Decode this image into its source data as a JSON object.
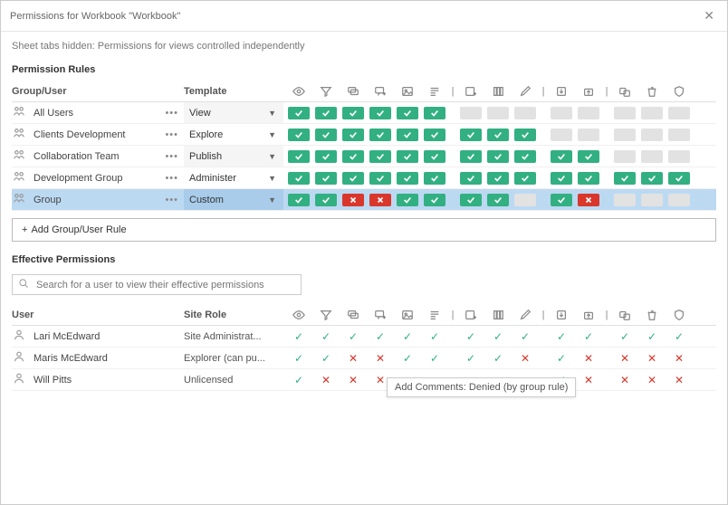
{
  "dialog": {
    "title": "Permissions for Workbook \"Workbook\"",
    "subtitle": "Sheet tabs hidden: Permissions for views controlled independently"
  },
  "sections": {
    "rules_title": "Permission Rules",
    "effective_title": "Effective Permissions"
  },
  "headers": {
    "group_user": "Group/User",
    "template": "Template",
    "user": "User",
    "site_role": "Site Role"
  },
  "perm_columns": [
    {
      "key": "view",
      "name": "view-icon"
    },
    {
      "key": "filter",
      "name": "filter-icon"
    },
    {
      "key": "comment",
      "name": "comment-icon"
    },
    {
      "key": "addcomment",
      "name": "add-comment-icon"
    },
    {
      "key": "image",
      "name": "image-icon"
    },
    {
      "key": "summary",
      "name": "summary-data-icon"
    },
    {
      "key": "SEP"
    },
    {
      "key": "share",
      "name": "share-custom-icon"
    },
    {
      "key": "fulldata",
      "name": "full-data-icon"
    },
    {
      "key": "webedit",
      "name": "web-edit-icon"
    },
    {
      "key": "SEP"
    },
    {
      "key": "download",
      "name": "download-workbook-icon"
    },
    {
      "key": "overwrite",
      "name": "overwrite-icon"
    },
    {
      "key": "SEP"
    },
    {
      "key": "move",
      "name": "move-icon"
    },
    {
      "key": "delete",
      "name": "delete-icon"
    },
    {
      "key": "setperm",
      "name": "set-permissions-icon"
    }
  ],
  "rules": [
    {
      "name": "All Users",
      "template": "View",
      "shaded": true,
      "perms": [
        "allow",
        "allow",
        "allow",
        "allow",
        "allow",
        "allow",
        "SEP",
        "none",
        "none",
        "none",
        "SEP",
        "none",
        "none",
        "SEP",
        "none",
        "none",
        "none"
      ]
    },
    {
      "name": "Clients Development",
      "template": "Explore",
      "shaded": false,
      "perms": [
        "allow",
        "allow",
        "allow",
        "allow",
        "allow",
        "allow",
        "SEP",
        "allow",
        "allow",
        "allow",
        "SEP",
        "none",
        "none",
        "SEP",
        "none",
        "none",
        "none"
      ]
    },
    {
      "name": "Collaboration Team",
      "template": "Publish",
      "shaded": true,
      "perms": [
        "allow",
        "allow",
        "allow",
        "allow",
        "allow",
        "allow",
        "SEP",
        "allow",
        "allow",
        "allow",
        "SEP",
        "allow",
        "allow",
        "SEP",
        "none",
        "none",
        "none"
      ]
    },
    {
      "name": "Development Group",
      "template": "Administer",
      "shaded": false,
      "perms": [
        "allow",
        "allow",
        "allow",
        "allow",
        "allow",
        "allow",
        "SEP",
        "allow",
        "allow",
        "allow",
        "SEP",
        "allow",
        "allow",
        "SEP",
        "allow",
        "allow",
        "allow"
      ]
    },
    {
      "name": "Group",
      "template": "Custom",
      "shaded": true,
      "selected": true,
      "perms": [
        "allow",
        "allow",
        "deny",
        "deny",
        "allow",
        "allow",
        "SEP",
        "allow",
        "allow",
        "none",
        "SEP",
        "allow",
        "deny",
        "SEP",
        "none",
        "none",
        "none"
      ]
    }
  ],
  "add_rule_label": "Add Group/User Rule",
  "search_placeholder": "Search for a user to view their effective permissions",
  "effective": [
    {
      "name": "Lari McEdward",
      "role": "Site Administrat...",
      "perms": [
        "allow",
        "allow",
        "allow",
        "allow",
        "allow",
        "allow",
        "SEP",
        "allow",
        "allow",
        "allow",
        "SEP",
        "allow",
        "allow",
        "SEP",
        "allow",
        "allow",
        "allow"
      ]
    },
    {
      "name": "Maris McEdward",
      "role": "Explorer (can pu...",
      "perms": [
        "allow",
        "allow",
        "deny",
        "deny",
        "allow",
        "allow",
        "SEP",
        "allow",
        "allow",
        "deny",
        "SEP",
        "allow",
        "deny",
        "SEP",
        "deny",
        "deny",
        "deny"
      ]
    },
    {
      "name": "Will Pitts",
      "role": "Unlicensed",
      "perms": [
        "allow",
        "deny",
        "deny",
        "deny",
        "TOOLTIP",
        "",
        "SEP",
        "",
        "",
        "",
        "SEP",
        "allow",
        "deny",
        "SEP",
        "deny",
        "deny",
        "deny"
      ]
    }
  ],
  "tooltip_text": "Add Comments: Denied (by group rule)"
}
